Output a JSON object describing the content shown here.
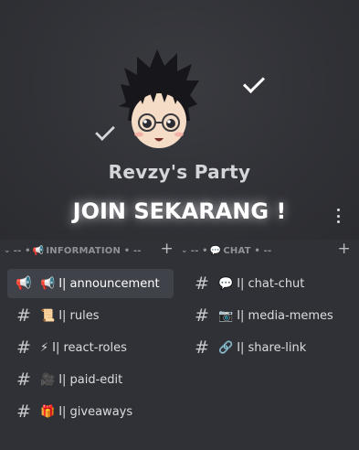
{
  "server": {
    "name": "Revzy's Party",
    "banner_title": "JOIN SEKARANG !"
  },
  "categories": [
    {
      "chevron": "⌄",
      "prefix": "-- •",
      "emoji": "📢",
      "label": "INFORMATION",
      "suffix": "• --",
      "add": "+"
    },
    {
      "chevron": "⌄",
      "prefix": "-- •",
      "emoji": "💬",
      "label": "CHAT",
      "suffix": "• --",
      "add": "+"
    }
  ],
  "channels_left": [
    {
      "lead": "📢",
      "emoji": "📢",
      "label": "Ι| announcement",
      "active": true
    },
    {
      "lead": "#",
      "emoji": "📜",
      "label": "Ι| rules",
      "active": false
    },
    {
      "lead": "#",
      "emoji": "⚡",
      "label": "Ι| react-roles",
      "active": false
    },
    {
      "lead": "#",
      "emoji": "🎥",
      "label": "Ι| paid-edit",
      "active": false
    },
    {
      "lead": "#",
      "emoji": "🎁",
      "label": "Ι| giveaways",
      "active": false
    }
  ],
  "channels_right": [
    {
      "lead": "#",
      "emoji": "💬",
      "label": "Ι| chat-chut",
      "active": false
    },
    {
      "lead": "#",
      "emoji": "📷",
      "label": "Ι| media-memes",
      "active": false
    },
    {
      "lead": "#",
      "emoji": "🔗",
      "label": "Ι| share-link",
      "active": false
    }
  ],
  "colors": {
    "background": "#303136",
    "active_channel": "#404249",
    "muted_text": "#8e9297"
  },
  "icons": {
    "menu": "kebab-menu-icon",
    "checkmark": "checkmark-icon"
  }
}
